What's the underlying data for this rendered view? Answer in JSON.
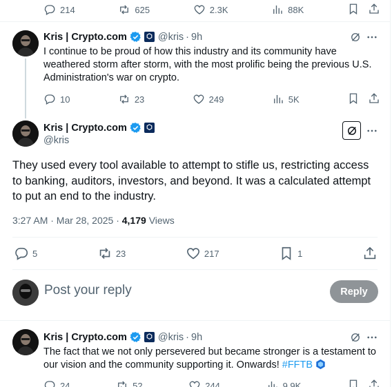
{
  "top_actions": {
    "replies": "214",
    "reposts": "625",
    "likes": "2.3K",
    "views": "88K"
  },
  "tweet1": {
    "name": "Kris | Crypto.com",
    "handle": "@kris",
    "time": "9h",
    "text": "I continue to be proud of how this industry and its community have weathered storm after storm, with the most prolific being the previous U.S. Administration's war on crypto.",
    "replies": "10",
    "reposts": "23",
    "likes": "249",
    "views": "5K"
  },
  "main_tweet": {
    "name": "Kris | Crypto.com",
    "handle": "@kris",
    "text": "They used every tool available to attempt to stifle us, restricting access to banking, auditors, investors, and beyond. It was a calculated attempt to put an end to the industry.",
    "timestamp": "3:27 AM · Mar 28, 2025 · ",
    "views_count": "4,179",
    "views_label": "Views",
    "replies": "5",
    "reposts": "23",
    "likes": "217",
    "bookmarks": "1"
  },
  "composer": {
    "placeholder": "Post your reply",
    "reply_label": "Reply"
  },
  "tweet3": {
    "name": "Kris | Crypto.com",
    "handle": "@kris",
    "time": "9h",
    "text": "The fact that we not only persevered but became stronger is a testament to our vision and the community supporting it. Onwards! ",
    "hashtag": "#FFTB",
    "replies": "24",
    "reposts": "52",
    "likes": "244",
    "views": "9.9K"
  },
  "colors": {
    "accent": "#1d9bf0",
    "muted": "#536471",
    "reply_button": "#8f9498",
    "divider": "#eff3f4"
  },
  "icons": [
    "reply-icon",
    "repost-icon",
    "like-icon",
    "views-icon",
    "bookmark-icon",
    "share-icon",
    "grok-icon",
    "more-icon",
    "verified-icon",
    "affiliate-badge-icon"
  ]
}
